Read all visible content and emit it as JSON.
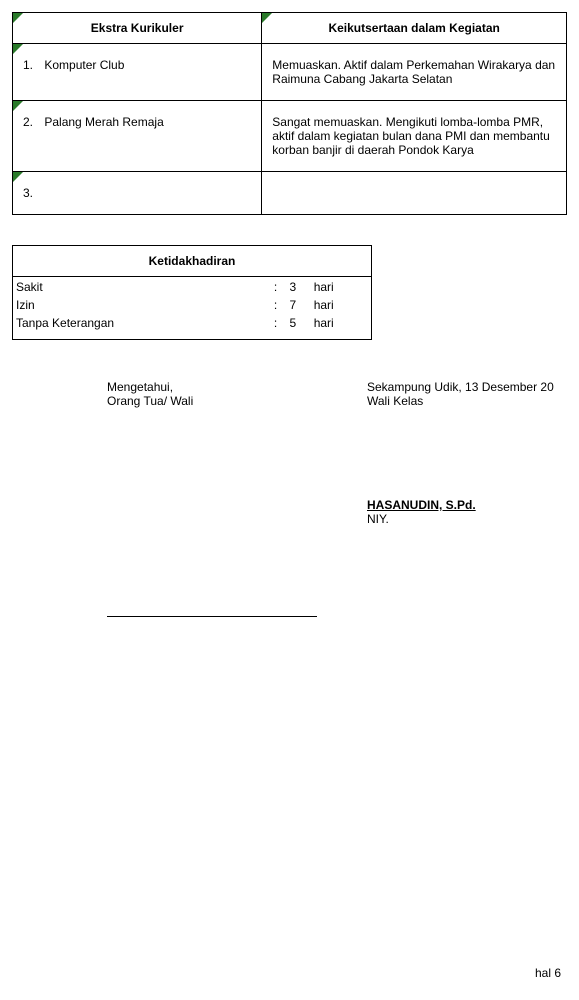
{
  "extracurricular": {
    "header_activity": "Ekstra Kurikuler",
    "header_participation": "Keikutsertaan dalam Kegiatan",
    "rows": [
      {
        "num": "1.",
        "name": "Komputer Club",
        "desc": "Memuaskan. Aktif dalam Perkemahan Wirakarya dan Raimuna Cabang Jakarta Selatan"
      },
      {
        "num": "2.",
        "name": "Palang Merah Remaja",
        "desc": "Sangat memuaskan. Mengikuti lomba-lomba PMR, aktif dalam kegiatan bulan dana PMI dan membantu korban banjir di daerah Pondok Karya"
      },
      {
        "num": "3.",
        "name": "",
        "desc": ""
      }
    ]
  },
  "absence": {
    "header": "Ketidakhadiran",
    "rows": [
      {
        "label": "Sakit",
        "colon": ":",
        "value": "3",
        "unit": "hari"
      },
      {
        "label": "Izin",
        "colon": ":",
        "value": "7",
        "unit": "hari"
      },
      {
        "label": "Tanpa Keterangan",
        "colon": ":",
        "value": "5",
        "unit": "hari"
      }
    ]
  },
  "signature": {
    "acknowledge": "Mengetahui,",
    "parent": "Orang Tua/ Wali",
    "place_date": "Sekampung Udik, 13 Desember 20",
    "homeroom": "Wali Kelas",
    "teacher_name": "HASANUDIN, S.Pd.",
    "niy": "NIY."
  },
  "page": {
    "num": "hal 6"
  }
}
